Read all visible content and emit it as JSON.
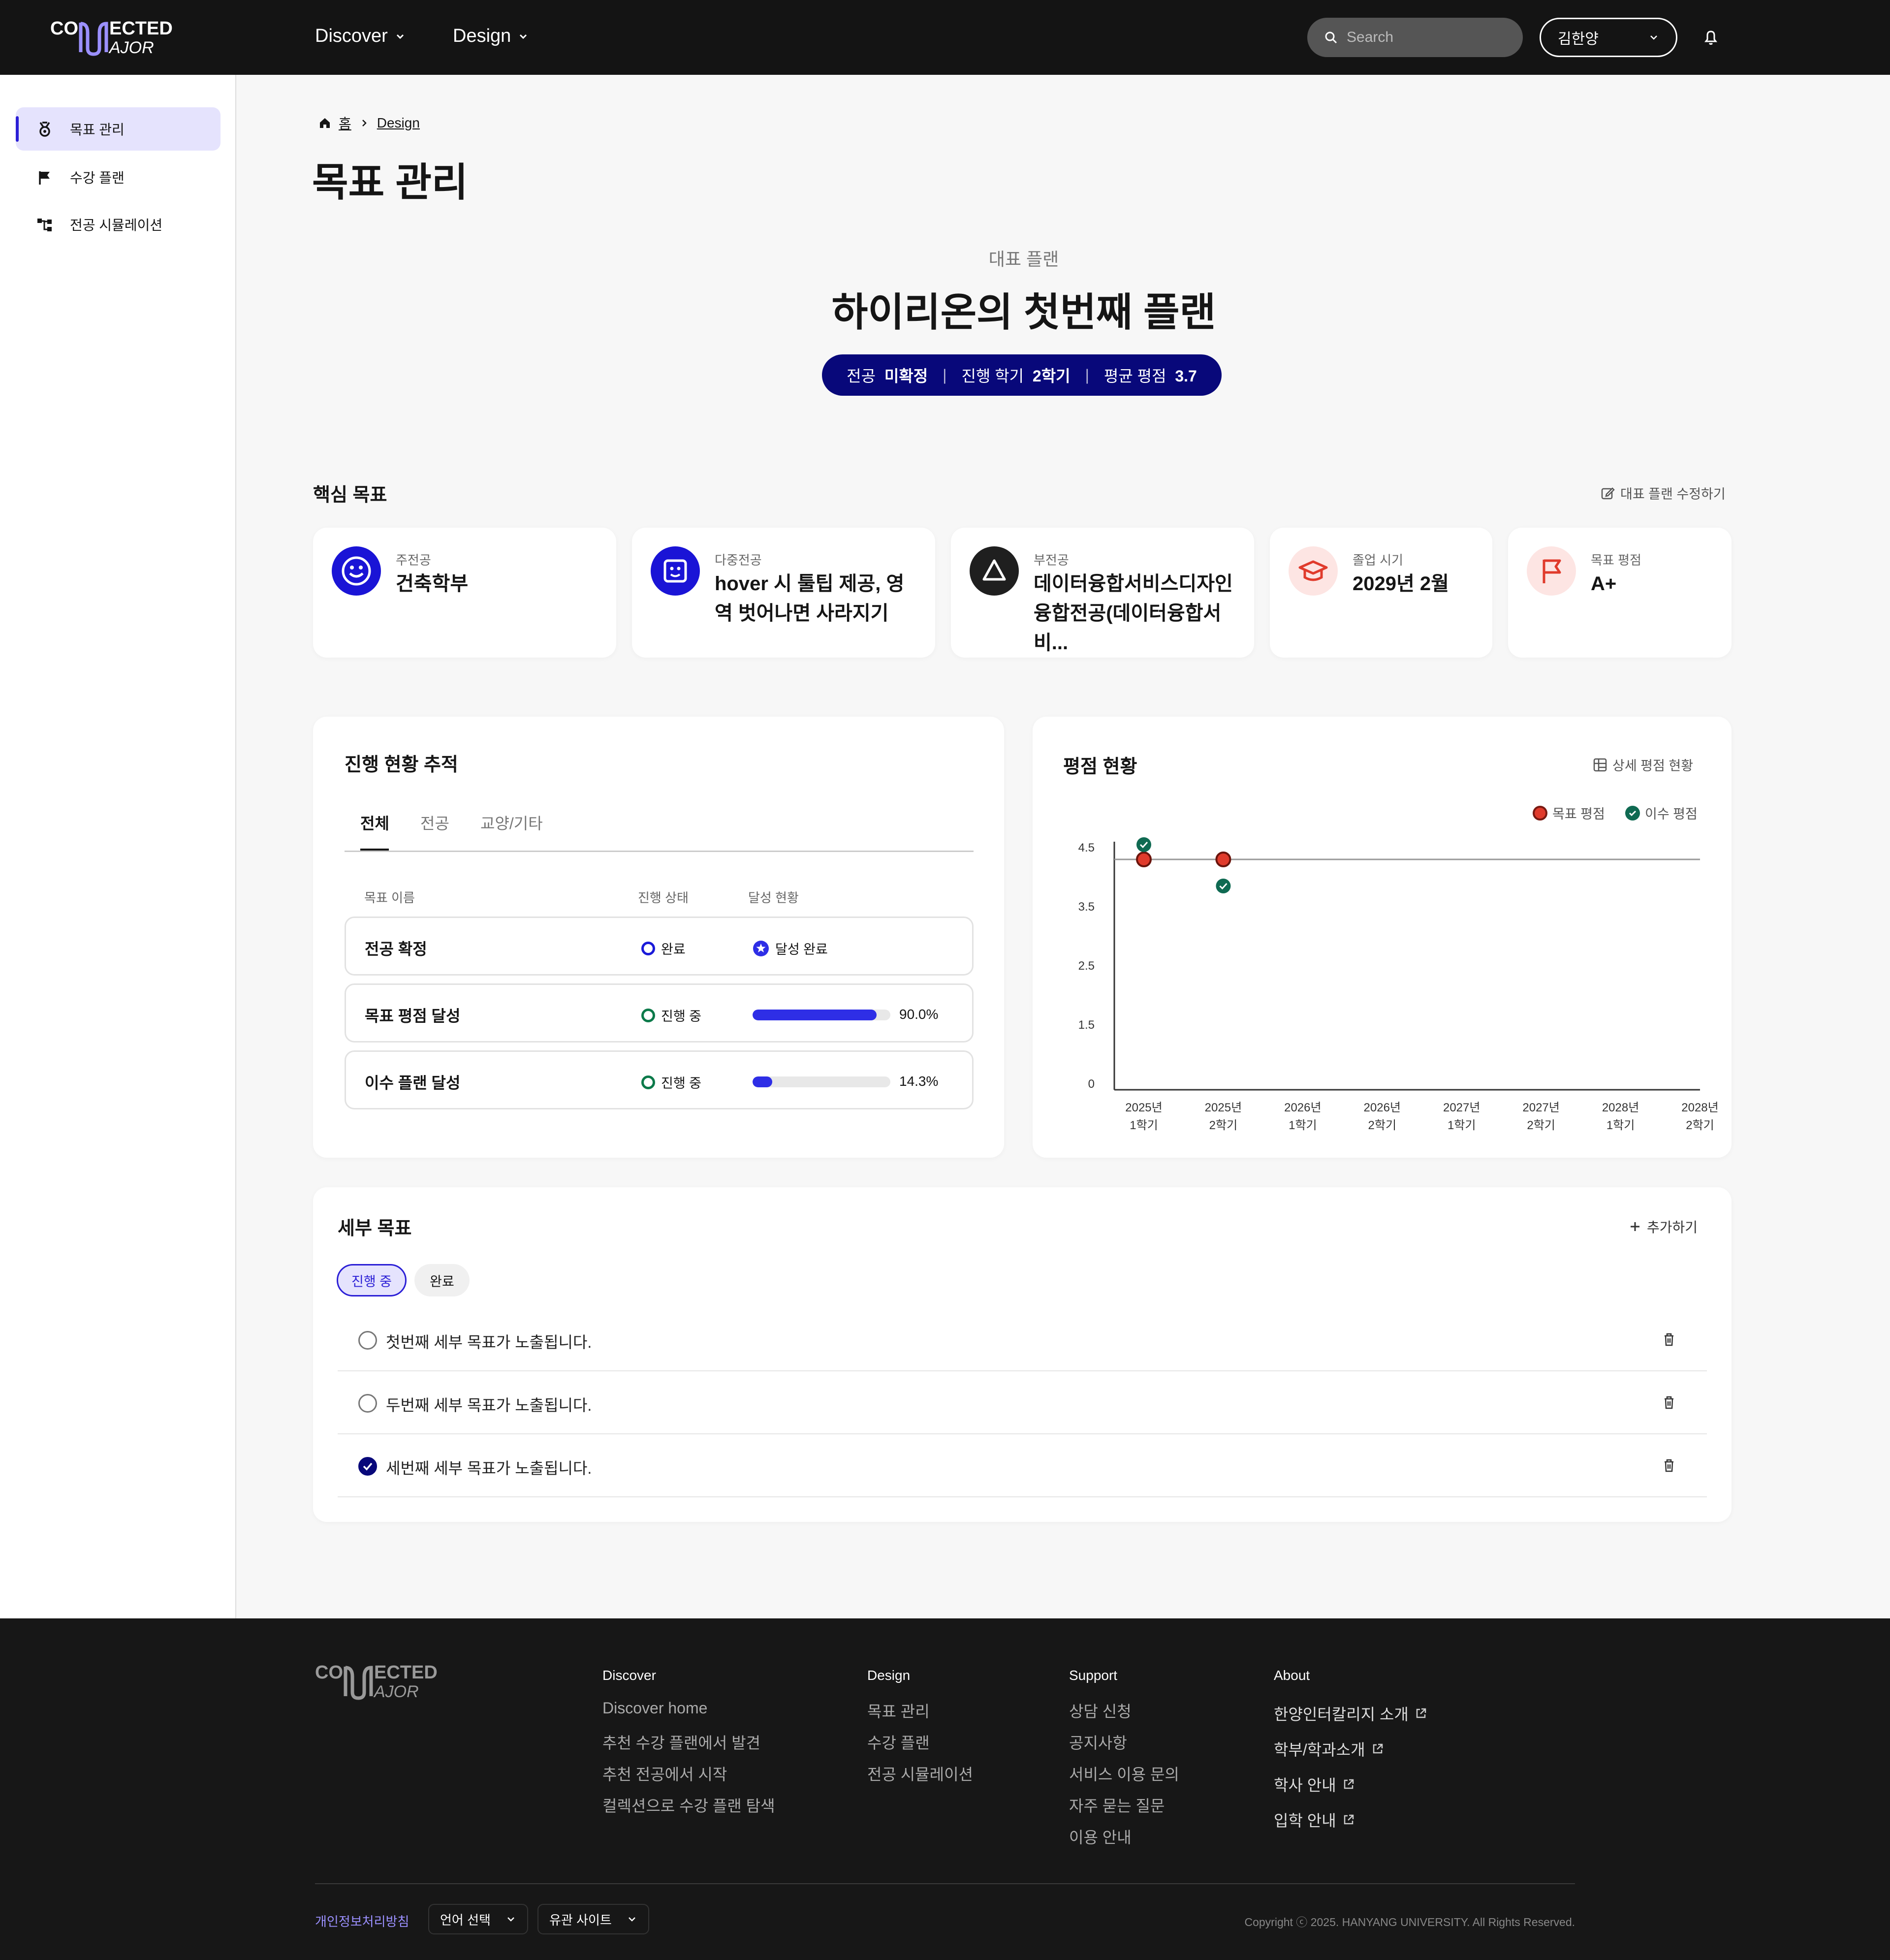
{
  "header": {
    "logo_top": "CONNECTED",
    "logo_bottom": "MAJOR",
    "nav": [
      "Discover",
      "Design"
    ],
    "search_placeholder": "Search",
    "user_name": "김한양"
  },
  "sidebar": {
    "items": [
      {
        "label": "목표 관리",
        "icon": "medal-icon",
        "active": true
      },
      {
        "label": "수강 플랜",
        "icon": "flag-icon",
        "active": false
      },
      {
        "label": "전공 시뮬레이션",
        "icon": "hierarchy-icon",
        "active": false
      }
    ]
  },
  "breadcrumb": {
    "home": "홈",
    "current": "Design"
  },
  "page_title": "목표 관리",
  "plan": {
    "eyebrow": "대표 플랜",
    "title": "하이리온의 첫번째 플랜",
    "pill": [
      {
        "label": "전공",
        "value": "미확정"
      },
      {
        "label": "진행 학기",
        "value": "2학기"
      },
      {
        "label": "평균 평점",
        "value": "3.7"
      }
    ]
  },
  "core_goals": {
    "title": "핵심 목표",
    "edit_label": "대표 플랜 수정하기",
    "cards": [
      {
        "label": "주전공",
        "value": "건축학부",
        "icon": "smile-face-icon"
      },
      {
        "label": "다중전공",
        "value": "hover 시 툴팁 제공, 영역 벗어나면 사라지기",
        "icon": "square-face-icon"
      },
      {
        "label": "부전공",
        "value": "데이터융합서비스디자인융합전공(데이터융합서비...",
        "icon": "triangle-icon"
      },
      {
        "label": "졸업 시기",
        "value": "2029년 2월",
        "icon": "graduation-cap-icon"
      },
      {
        "label": "목표 평점",
        "value": "A+",
        "icon": "flag-icon"
      }
    ]
  },
  "progress": {
    "title": "진행 현황 추적",
    "tabs": [
      "전체",
      "전공",
      "교양/기타"
    ],
    "columns": [
      "목표 이름",
      "진행 상태",
      "달성 현황"
    ],
    "rows": [
      {
        "name": "전공 확정",
        "status": "완료",
        "achievement": "달성 완료",
        "progress": null
      },
      {
        "name": "목표 평점 달성",
        "status": "진행 중",
        "achievement": "90.0%",
        "progress": 90.0
      },
      {
        "name": "이수 플랜 달성",
        "status": "진행 중",
        "achievement": "14.3%",
        "progress": 14.3
      }
    ],
    "colors": {
      "done": "#1a1ad9",
      "in_progress": "#0c7a4a",
      "bar": "#2e2ee6"
    }
  },
  "grade": {
    "title": "평점 현황",
    "detail_label": "상세 평점 현황",
    "legend": [
      {
        "name": "목표 평점",
        "color": "#e03b2c"
      },
      {
        "name": "이수 평점",
        "color": "#0f6a52"
      }
    ]
  },
  "chart_data": {
    "type": "scatter",
    "x_categories": [
      [
        "2025년",
        "1학기"
      ],
      [
        "2025년",
        "2학기"
      ],
      [
        "2026년",
        "1학기"
      ],
      [
        "2026년",
        "2학기"
      ],
      [
        "2027년",
        "1학기"
      ],
      [
        "2027년",
        "2학기"
      ],
      [
        "2028년",
        "1학기"
      ],
      [
        "2028년",
        "2학기"
      ]
    ],
    "y_ticks": [
      "4.5",
      "3.5",
      "2.5",
      "1.5",
      "0"
    ],
    "target_line": 4.3,
    "series": [
      {
        "name": "목표 평점",
        "color": "#e03b2c",
        "values": [
          4.3,
          4.3
        ]
      },
      {
        "name": "이수 평점",
        "color": "#0f6a52",
        "values": [
          4.55,
          3.85
        ]
      }
    ],
    "legend_position": "top-right"
  },
  "sub_goals": {
    "title": "세부 목표",
    "add_label": "추가하기",
    "filters": [
      "진행 중",
      "완료"
    ],
    "items": [
      {
        "text": "첫번째 세부 목표가 노출됩니다.",
        "done": false
      },
      {
        "text": "두번째 세부 목표가 노출됩니다.",
        "done": false
      },
      {
        "text": "세번째 세부 목표가 노출됩니다.",
        "done": true
      }
    ]
  },
  "footer": {
    "columns": [
      {
        "title": "Discover",
        "links": [
          "Discover home",
          "추천 수강 플랜에서 발견",
          "추천 전공에서 시작",
          "컬렉션으로 수강 플랜 탐색"
        ]
      },
      {
        "title": "Design",
        "links": [
          "목표 관리",
          "수강 플랜",
          "전공 시뮬레이션"
        ]
      },
      {
        "title": "Support",
        "links": [
          "상담 신청",
          "공지사항",
          "서비스 이용 문의",
          "자주 묻는 질문",
          "이용 안내"
        ]
      },
      {
        "title": "About",
        "links": [
          "한양인터칼리지 소개",
          "학부/학과소개",
          "학사 안내",
          "입학 안내"
        ]
      }
    ],
    "privacy": "개인정보처리방침",
    "language_select": "언어 선택",
    "related_select": "유관 사이트",
    "copyright": "Copyright ⓒ 2025. HANYANG UNIVERSITY. All Rights Reserved."
  }
}
